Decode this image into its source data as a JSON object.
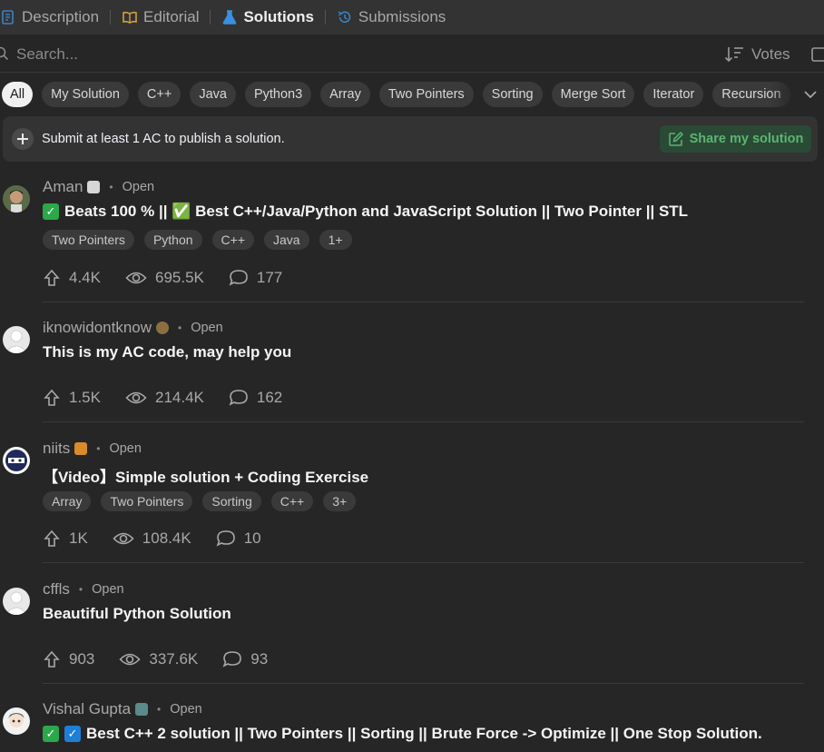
{
  "tabs": [
    {
      "label": "Description",
      "icon": "description-icon"
    },
    {
      "label": "Editorial",
      "icon": "book-icon"
    },
    {
      "label": "Solutions",
      "icon": "flask-icon",
      "active": true
    },
    {
      "label": "Submissions",
      "icon": "history-icon"
    }
  ],
  "search": {
    "placeholder": "Search..."
  },
  "sort": {
    "label": "Votes"
  },
  "filters": [
    "All",
    "My Solution",
    "C++",
    "Java",
    "Python3",
    "Array",
    "Two Pointers",
    "Sorting",
    "Merge Sort",
    "Iterator",
    "Recursion"
  ],
  "publish": {
    "text": "Submit at least 1 AC to publish a solution.",
    "button": "Share my solution"
  },
  "colors": {
    "accent_green": "#2ba84a",
    "accent_blue": "#1e7fd8",
    "share_text": "#5ab572",
    "background": "#262626"
  },
  "posts": [
    {
      "author": "Aman",
      "status": "Open",
      "title": "Beats 100 % || ✅ Best C++/Java/Python and JavaScript Solution || Two Pointer || STL",
      "title_prefix_checks": [
        "green"
      ],
      "tags": [
        "Two Pointers",
        "Python",
        "C++",
        "Java",
        "1+"
      ],
      "upvotes": "4.4K",
      "views": "695.5K",
      "comments": "177"
    },
    {
      "author": "iknowidontknow",
      "status": "Open",
      "title": "This is my AC code, may help you",
      "tags": [],
      "upvotes": "1.5K",
      "views": "214.4K",
      "comments": "162"
    },
    {
      "author": "niits",
      "status": "Open",
      "title": "【Video】Simple solution + Coding Exercise",
      "tags": [
        "Array",
        "Two Pointers",
        "Sorting",
        "C++",
        "3+"
      ],
      "upvotes": "1K",
      "views": "108.4K",
      "comments": "10"
    },
    {
      "author": "cffls",
      "status": "Open",
      "title": "Beautiful Python Solution",
      "tags": [],
      "upvotes": "903",
      "views": "337.6K",
      "comments": "93"
    },
    {
      "author": "Vishal Gupta",
      "status": "Open",
      "title": "Best C++ 2 solution || Two Pointers || Sorting || Brute Force -> Optimize || One Stop Solution.",
      "tags": []
    }
  ]
}
